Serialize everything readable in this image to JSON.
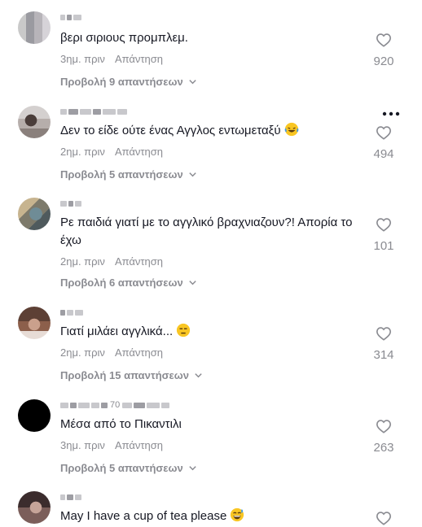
{
  "comments": [
    {
      "text": "βερι σιριους προμπλεμ.",
      "time": "3ημ. πριν",
      "reply": "Απάντηση",
      "likes": "920",
      "view_replies": "Προβολή 9 απαντήσεων",
      "username_visible": "",
      "avatar": "pix1",
      "emoji": ""
    },
    {
      "text": "Δεν το είδε ούτε ένας Αγγλος εντωμεταξύ",
      "time": "2ημ. πριν",
      "reply": "Απάντηση",
      "likes": "494",
      "view_replies": "Προβολή 5 απαντήσεων",
      "username_visible": "",
      "avatar": "pix2",
      "emoji": "laughing-crying"
    },
    {
      "text": "Ρε παιδιά γιατί με το αγγλικό βραχνιαζουν?! Απορία το έχω",
      "time": "2ημ. πριν",
      "reply": "Απάντηση",
      "likes": "101",
      "view_replies": "Προβολή 6 απαντήσεων",
      "username_visible": "",
      "avatar": "pix3",
      "emoji": ""
    },
    {
      "text": "Γιατί μιλάει αγγλικά...",
      "time": "2ημ. πριν",
      "reply": "Απάντηση",
      "likes": "314",
      "view_replies": "Προβολή 15 απαντήσεων",
      "username_visible": "",
      "avatar": "pix4",
      "emoji": "unamused"
    },
    {
      "text": "Μέσα από το Πικαντιλι",
      "time": "3ημ. πριν",
      "reply": "Απάντηση",
      "likes": "263",
      "view_replies": "Προβολή 5 απαντήσεων",
      "username_visible": "70",
      "avatar": "black",
      "emoji": ""
    },
    {
      "text": "May I have a cup of tea please",
      "time": "",
      "reply": "",
      "likes": "",
      "view_replies": "",
      "username_visible": "",
      "avatar": "pix6",
      "emoji": "grinning-sweat"
    }
  ],
  "colors": {
    "text": "#161823",
    "muted": "#8a8b91",
    "background": "#ffffff"
  },
  "icons": {
    "like": "heart-outline-icon",
    "more": "more-dots-icon",
    "expand": "chevron-down-icon"
  }
}
